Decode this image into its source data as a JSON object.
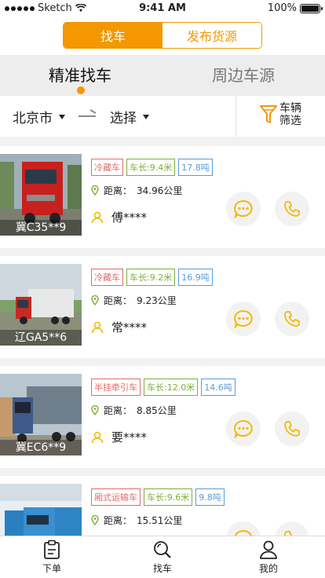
{
  "status_bar": {
    "carrier": "Sketch",
    "time": "9:41 AM",
    "battery": "100%"
  },
  "top_segment": {
    "active": "找车",
    "inactive": "发布货源"
  },
  "tabs": {
    "selected": "精准找车",
    "other": "周边车源"
  },
  "filter": {
    "origin": "北京市",
    "destination": "选择",
    "filter_label_line1": "车辆",
    "filter_label_line2": "筛选"
  },
  "labels": {
    "distance_prefix": "距离："
  },
  "cards": [
    {
      "plate": "冀C35**9",
      "type": "冷藏车",
      "length": "车长:9.4米",
      "weight": "17.8吨",
      "distance": "34.96公里",
      "driver": "傅****"
    },
    {
      "plate": "辽GA5**6",
      "type": "冷藏车",
      "length": "车长:9.2米",
      "weight": "16.9吨",
      "distance": "9.23公里",
      "driver": "常****"
    },
    {
      "plate": "冀EC6**9",
      "type": "半挂牵引车",
      "length": "车长:12.0米",
      "weight": "14.6吨",
      "distance": "8.85公里",
      "driver": "要****"
    },
    {
      "plate": "",
      "type": "厢式运输车",
      "length": "车长:9.6米",
      "weight": "9.8吨",
      "distance": "15.51公里",
      "driver": ""
    }
  ],
  "bottom_nav": {
    "item1": "下单",
    "item2": "找车",
    "item3": "我的"
  },
  "colors": {
    "accent": "#f39800",
    "tag_red": "#e36b6b",
    "tag_green": "#7cae3b",
    "tag_blue": "#5b9bd5"
  }
}
